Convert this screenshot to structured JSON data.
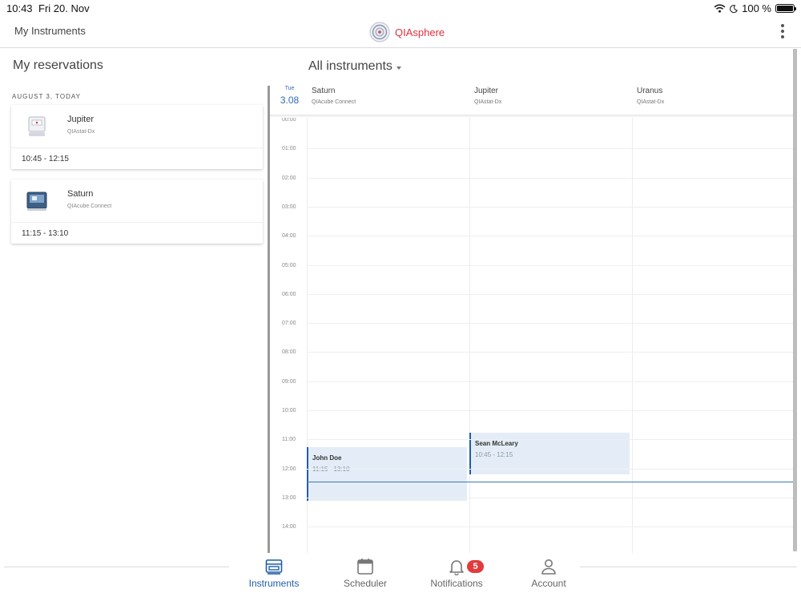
{
  "status_bar": {
    "time": "10:43",
    "date": "Fri 20. Nov",
    "battery": "100 %",
    "battery_level": 1.0
  },
  "header": {
    "title": "My Instruments",
    "brand": "QIAsphere"
  },
  "left_panel": {
    "title": "My reservations",
    "date_heading": "AUGUST 3, TODAY",
    "reservations": [
      {
        "instrument": "Jupiter",
        "model": "QIAstat-Dx",
        "time": "10:45 - 12:15"
      },
      {
        "instrument": "Saturn",
        "model": "QIAcube Connect",
        "time": "11:15 - 13:10"
      }
    ]
  },
  "scheduler": {
    "title": "All instruments",
    "day": {
      "name": "Tue",
      "date": "3.08"
    },
    "resources": [
      {
        "name": "Saturn",
        "model": "QIAcube Connect"
      },
      {
        "name": "Jupiter",
        "model": "QIAstat-Dx"
      },
      {
        "name": "Uranus",
        "model": "QIAstat-Dx"
      }
    ],
    "hours": [
      "00:00",
      "01:00",
      "02:00",
      "03:00",
      "04:00",
      "05:00",
      "06:00",
      "07:00",
      "08:00",
      "09:00",
      "10:00",
      "11:00",
      "12:00",
      "13:00",
      "14:00"
    ],
    "events": [
      {
        "resource": "Saturn",
        "user": "John Doe",
        "time": "11:15 - 13:10"
      },
      {
        "resource": "Jupiter",
        "user": "Sean McLeary",
        "time": "10:45 - 12:15"
      }
    ],
    "current_time": "12:30"
  },
  "tabs": [
    {
      "label": "Instruments",
      "icon": "instrument-icon",
      "active": true
    },
    {
      "label": "Scheduler",
      "icon": "calendar-icon",
      "active": false
    },
    {
      "label": "Notifications",
      "icon": "bell-icon",
      "active": false,
      "badge": "5"
    },
    {
      "label": "Account",
      "icon": "person-icon",
      "active": false
    }
  ],
  "colors": {
    "brand": "#e0313f",
    "accent": "#1f5fa8",
    "event_bg": "#e4edf7",
    "badge": "#e33b3b"
  }
}
